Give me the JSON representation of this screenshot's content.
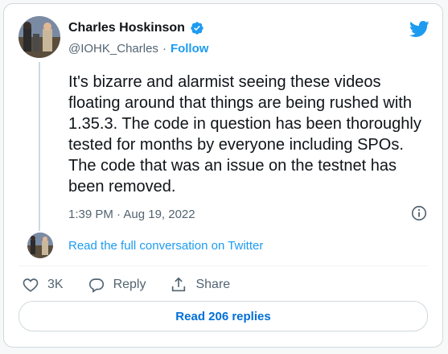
{
  "author": {
    "name": "Charles Hoskinson",
    "handle": "@IOHK_Charles",
    "separator": "·",
    "follow_label": "Follow"
  },
  "tweet": {
    "text": "It's bizarre and alarmist seeing these videos floating around that things are being rushed with 1.35.3. The code in question has been thoroughly tested for months by everyone including SPOs. The code that was an issue on the testnet has been removed.",
    "timestamp": "1:39 PM · Aug 19, 2022"
  },
  "conversation_link": "Read the full conversation on Twitter",
  "actions": {
    "like_count": "3K",
    "reply_label": "Reply",
    "share_label": "Share"
  },
  "read_replies_label": "Read 206 replies",
  "colors": {
    "brand_blue": "#1d9bf0",
    "text_primary": "#0f1419",
    "text_secondary": "#536471",
    "border": "#cfd9de"
  },
  "icons": [
    "verified-badge-icon",
    "twitter-bird-icon",
    "info-icon",
    "heart-icon",
    "reply-icon",
    "share-icon"
  ]
}
